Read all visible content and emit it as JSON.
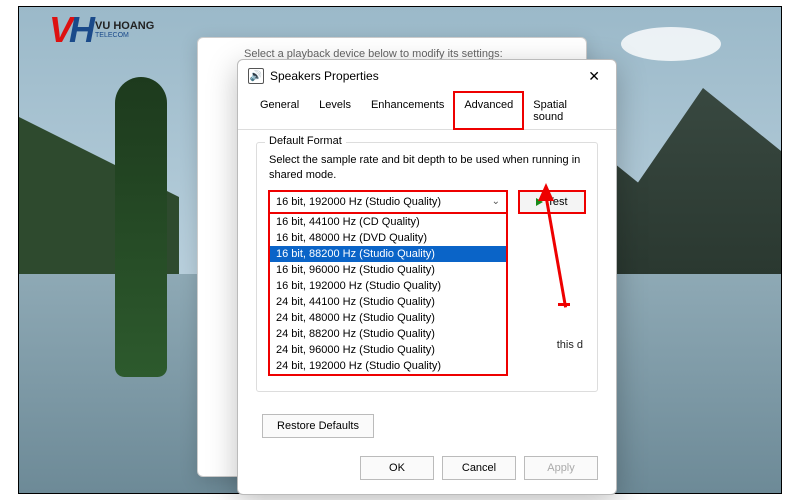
{
  "logo": {
    "brand": "VU HOANG",
    "sub": "TELECOM"
  },
  "backdlg_hint": "Select a playback device below to modify its settings:",
  "dialog": {
    "title": "Speakers Properties",
    "tabs": [
      "General",
      "Levels",
      "Enhancements",
      "Advanced",
      "Spatial sound"
    ],
    "active_tab": "Advanced",
    "group_label": "Default Format",
    "desc": "Select the sample rate and bit depth to be used when running in shared mode.",
    "selected": "16 bit, 192000 Hz (Studio Quality)",
    "test_label": "Test",
    "options": [
      "16 bit, 44100 Hz (CD Quality)",
      "16 bit, 48000 Hz (DVD Quality)",
      "16 bit, 88200 Hz (Studio Quality)",
      "16 bit, 96000 Hz (Studio Quality)",
      "16 bit, 192000 Hz (Studio Quality)",
      "24 bit, 44100 Hz (Studio Quality)",
      "24 bit, 48000 Hz (Studio Quality)",
      "24 bit, 88200 Hz (Studio Quality)",
      "24 bit, 96000 Hz (Studio Quality)",
      "24 bit, 192000 Hz (Studio Quality)"
    ],
    "highlighted_option_index": 2,
    "trailing_text": "this d",
    "restore": "Restore Defaults",
    "ok": "OK",
    "cancel": "Cancel",
    "apply": "Apply"
  }
}
